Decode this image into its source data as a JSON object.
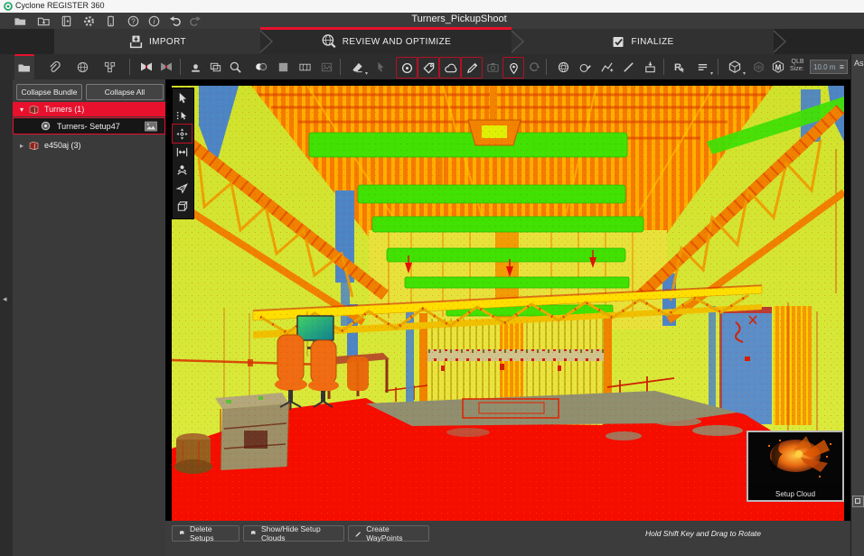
{
  "window": {
    "app_title": "Cyclone REGISTER 360",
    "project_title": "Turners_PickupShoot"
  },
  "workflow": {
    "steps": [
      {
        "id": "import",
        "label": "IMPORT",
        "active": false
      },
      {
        "id": "review",
        "label": "REVIEW AND OPTIMIZE",
        "active": true
      },
      {
        "id": "finalize",
        "label": "FINALIZE",
        "active": false
      }
    ]
  },
  "menu_icons": [
    "open-project",
    "save-project",
    "archive",
    "settings",
    "device",
    "help",
    "info",
    "undo",
    "redo"
  ],
  "toolbar": {
    "qlb_label_top": "QLB",
    "qlb_label_bottom": "Size:",
    "qlb_value": "10.0 m",
    "icons": [
      "project-folder",
      "link",
      "web",
      "sites",
      "split-view-a",
      "split-view-b",
      "stamp",
      "frames",
      "zoom",
      "colorize",
      "grayscale",
      "panorama",
      "image",
      "eraser",
      "pick-cursor",
      "target",
      "tag",
      "cloud",
      "marker-pen",
      "camera",
      "location-pin",
      "curve",
      "sphere",
      "sphere-annotate",
      "polyline-add",
      "line",
      "drop-box",
      "r-tool",
      "list-menu",
      "cube-views",
      "cube-hide",
      "cube-modelspace"
    ]
  },
  "assets_panel": {
    "label": "Assets"
  },
  "left_panel": {
    "collapse_bundle_label": "Collapse Bundle",
    "collapse_all_label": "Collapse All",
    "tree": [
      {
        "label": "Turners (1)",
        "expanded": true,
        "selected": true
      },
      {
        "label": "Turners- Setup47",
        "selected": true
      },
      {
        "label": "e450aj (3)",
        "expanded": false
      }
    ]
  },
  "viewport": {
    "rotate_hint": "Hold Shift Key and Drag to Rotate",
    "setup_cloud_label": "Setup Cloud",
    "palette_icons": [
      "select-arrow",
      "fence-select",
      "orbit-pan",
      "measure",
      "viewer-person",
      "fly",
      "box-mode"
    ],
    "active_palette_tool": "orbit-pan"
  },
  "bottom_bar": {
    "buttons": [
      {
        "label": "Delete Setups"
      },
      {
        "label": "Show/Hide Setup Clouds"
      },
      {
        "label": "Create WayPoints"
      }
    ]
  },
  "glyphs": {
    "caret_down": "▾",
    "caret_right": "▸",
    "collapse_left": "◂",
    "help": "?",
    "info": "i",
    "cube_m": "M",
    "r_letter": "R",
    "slider": "≡"
  },
  "colors": {
    "accent_red": "#e8112d",
    "toolbar_bg": "#2d2d2d",
    "panel_bg": "#3a3a3a",
    "floor_red": "#f50d00",
    "wall_yellow": "#d8e832",
    "beam_green": "#3fe203",
    "column_blue": "#4c85c6"
  }
}
